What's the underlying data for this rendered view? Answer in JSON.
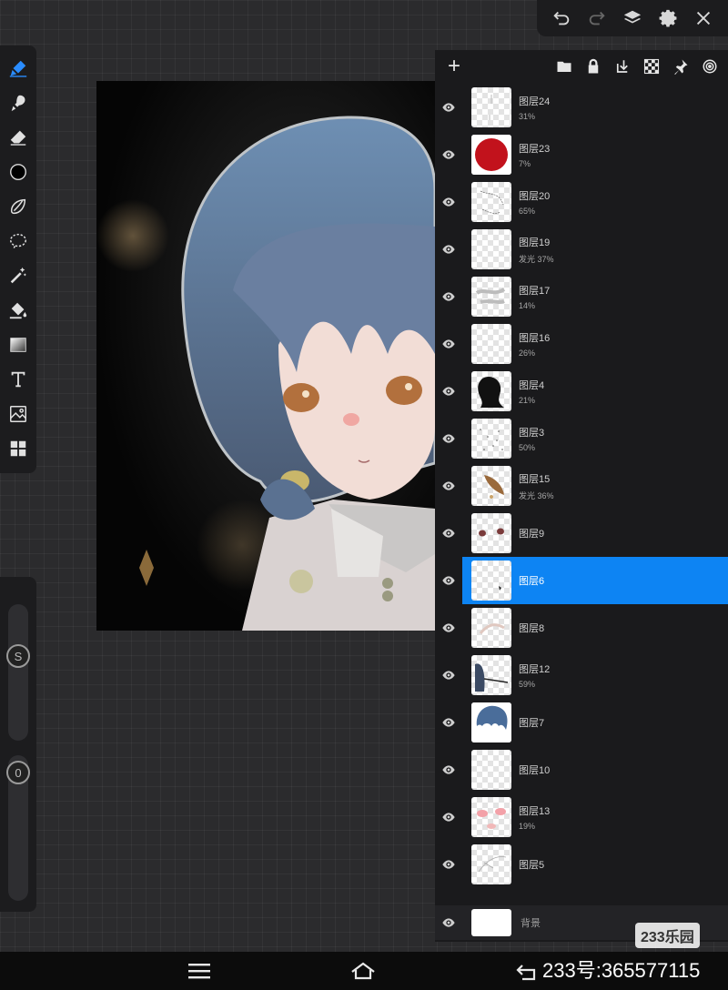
{
  "top_bar": {
    "icons": [
      "undo-icon",
      "redo-icon",
      "layers-icon",
      "settings-icon",
      "close-icon"
    ]
  },
  "toolbar": {
    "tools": [
      "brush-icon",
      "smudge-icon",
      "eraser-icon",
      "color-icon",
      "lasso-icon",
      "selection-icon",
      "magic-wand-icon",
      "fill-icon",
      "gradient-icon",
      "text-icon",
      "image-icon",
      "grid-icon"
    ]
  },
  "sliders": {
    "size_label": "S",
    "opacity_label": "0"
  },
  "layer_panel": {
    "header_icons": [
      "add-icon",
      "folder-icon",
      "lock-icon",
      "merge-down-icon",
      "checker-icon",
      "pin-icon",
      "target-icon"
    ],
    "layers": [
      {
        "name": "图层24",
        "sub": "31%",
        "thumb": "faint"
      },
      {
        "name": "图层23",
        "sub": "7%",
        "thumb": "red-circle"
      },
      {
        "name": "图层20",
        "sub": "65%",
        "thumb": "sketch"
      },
      {
        "name": "图层19",
        "sub": "发光   37%",
        "thumb": "empty"
      },
      {
        "name": "图层17",
        "sub": "14%",
        "thumb": "gray-stroke"
      },
      {
        "name": "图层16",
        "sub": "26%",
        "thumb": "empty"
      },
      {
        "name": "图层4",
        "sub": "21%",
        "thumb": "dark-silhouette"
      },
      {
        "name": "图层3",
        "sub": "50%",
        "thumb": "dots"
      },
      {
        "name": "图层15",
        "sub": "发光   36%",
        "thumb": "brown-shape"
      },
      {
        "name": "图层9",
        "sub": "",
        "thumb": "eyes"
      },
      {
        "name": "图层6",
        "sub": "",
        "thumb": "tiny-mark",
        "selected": true
      },
      {
        "name": "图层8",
        "sub": "",
        "thumb": "light-sketch"
      },
      {
        "name": "图层12",
        "sub": "59%",
        "thumb": "hair-side"
      },
      {
        "name": "图层7",
        "sub": "",
        "thumb": "hair"
      },
      {
        "name": "图层10",
        "sub": "",
        "thumb": "empty"
      },
      {
        "name": "图层13",
        "sub": "19%",
        "thumb": "blush"
      },
      {
        "name": "图层5",
        "sub": "",
        "thumb": "line-sketch"
      }
    ],
    "background_layer": {
      "name": "背景"
    }
  },
  "watermark": {
    "logo": "233乐园",
    "text": "233号:365577115"
  },
  "colors": {
    "accent": "#0d84f3",
    "active_tool": "#2a8cff",
    "panel_bg": "#1a1a1c"
  }
}
